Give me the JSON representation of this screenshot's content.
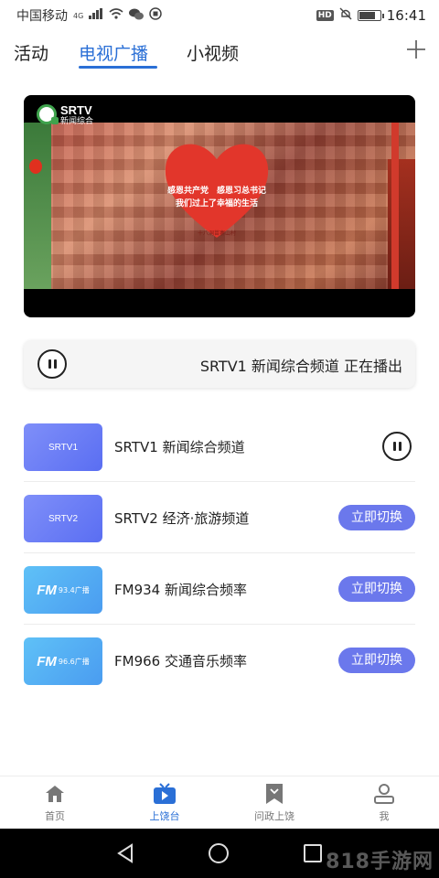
{
  "status_bar": {
    "carrier": "中国移动",
    "network": "4G",
    "time": "16:41",
    "hd": "HD",
    "battery_level": 0.7,
    "icons": [
      "signal-icon",
      "wifi-icon",
      "wechat-icon",
      "app-notification-icon",
      "hd-icon",
      "mute-icon",
      "battery-icon"
    ]
  },
  "tabs": {
    "items": [
      {
        "label": "活动"
      },
      {
        "label": "电视广播"
      },
      {
        "label": "小视频"
      }
    ],
    "active_index": 1,
    "add_icon": "plus-icon"
  },
  "player": {
    "logo_title": "SRTV",
    "logo_subtitle": "新闻综合",
    "heart_line1": "感恩共产党　感恩习总书记",
    "heart_line2": "我们过上了幸福的生活",
    "heart_caption": "十八洞苗寨山村"
  },
  "now_playing": {
    "text": "SRTV1 新闻综合频道 正在播出",
    "control_icon": "pause-icon"
  },
  "channels": [
    {
      "thumb_label": "SRTV1",
      "name": "SRTV1 新闻综合频道",
      "playing": true,
      "kind": "tv"
    },
    {
      "thumb_label": "SRTV2",
      "name": "SRTV2 经济·旅游频道",
      "action": "立即切换",
      "kind": "tv"
    },
    {
      "thumb_logo": "FM",
      "thumb_freq": "93.4广播",
      "name": "FM934 新闻综合频率",
      "action": "立即切换",
      "kind": "fm"
    },
    {
      "thumb_logo": "FM",
      "thumb_freq": "96.6广播",
      "name": "FM966 交通音乐频率",
      "action": "立即切换",
      "kind": "fm"
    }
  ],
  "bottom_nav": {
    "items": [
      {
        "label": "首页",
        "icon": "home-icon"
      },
      {
        "label": "上饶台",
        "icon": "tv-icon"
      },
      {
        "label": "问政上饶",
        "icon": "bookmark-icon"
      },
      {
        "label": "我",
        "icon": "profile-icon"
      }
    ],
    "active_index": 1
  },
  "system_nav": {
    "watermark": "818手游网"
  },
  "colors": {
    "accent": "#2a6fd6",
    "switch_button": "#6b78ec",
    "tv_thumb": "#6f7ff6",
    "fm_thumb": "#55b0f4"
  }
}
